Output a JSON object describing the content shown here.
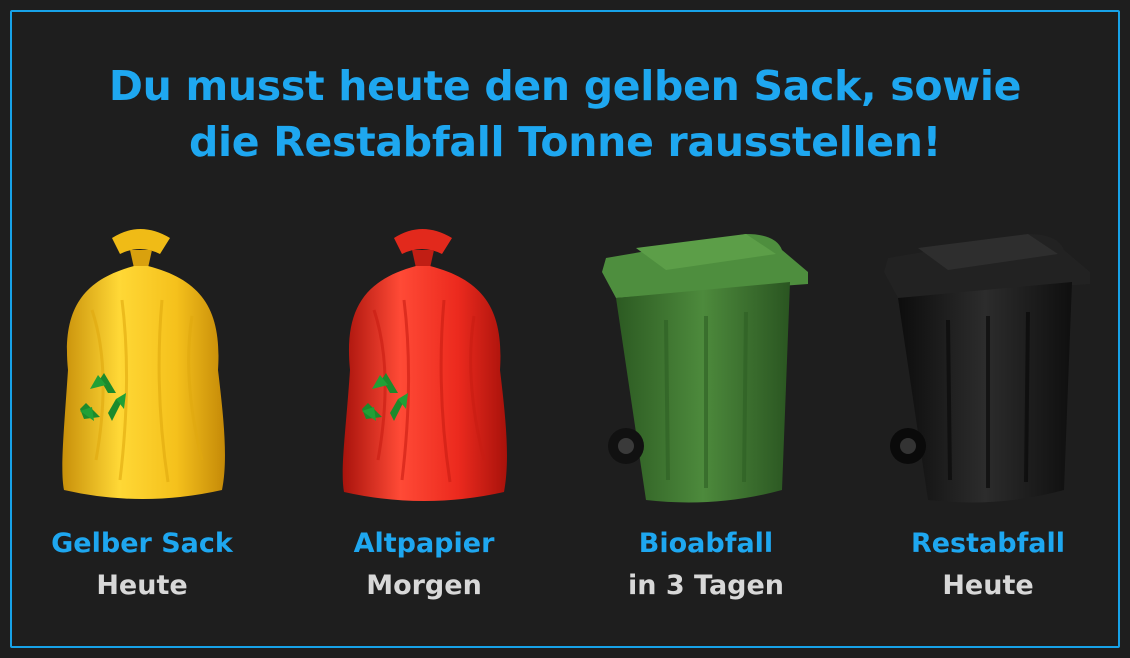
{
  "headline": {
    "line1": "Du musst heute den gelben Sack, sowie",
    "line2": "die Restabfall Tonne rausstellen!"
  },
  "items": [
    {
      "name": "Gelber Sack",
      "when": "Heute",
      "icon": "yellow-bag-icon",
      "color": "#f2c21a"
    },
    {
      "name": "Altpapier",
      "when": "Morgen",
      "icon": "red-bag-icon",
      "color": "#e8231c"
    },
    {
      "name": "Bioabfall",
      "when": "in 3 Tagen",
      "icon": "green-bin-icon",
      "color": "#3f7a32"
    },
    {
      "name": "Restabfall",
      "when": "Heute",
      "icon": "black-bin-icon",
      "color": "#1b1b1b"
    }
  ],
  "colors": {
    "accent": "#1ea7f0",
    "background": "#1e1e1e",
    "subtext": "#d8d8d8"
  }
}
